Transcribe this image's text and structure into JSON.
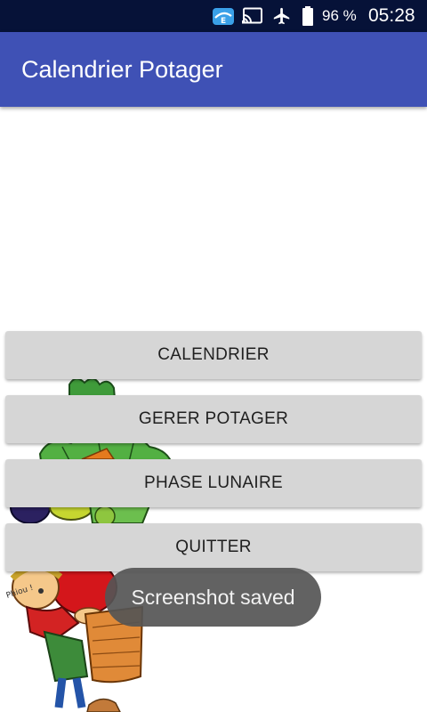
{
  "status_bar": {
    "battery_percent": "96 %",
    "time": "05:28",
    "icons": [
      "app-notification-icon",
      "cast-icon",
      "airplane-mode-icon",
      "battery-icon"
    ]
  },
  "app_bar": {
    "title": "Calendrier Potager"
  },
  "menu": {
    "buttons": [
      {
        "label": "CALENDRIER"
      },
      {
        "label": "GERER POTAGER"
      },
      {
        "label": "PHASE LUNAIRE"
      },
      {
        "label": "QUITTER"
      }
    ]
  },
  "toast": {
    "message": "Screenshot saved"
  },
  "colors": {
    "primary": "#3f51b5",
    "status_bar": "#061238",
    "button": "#d6d6d6"
  }
}
